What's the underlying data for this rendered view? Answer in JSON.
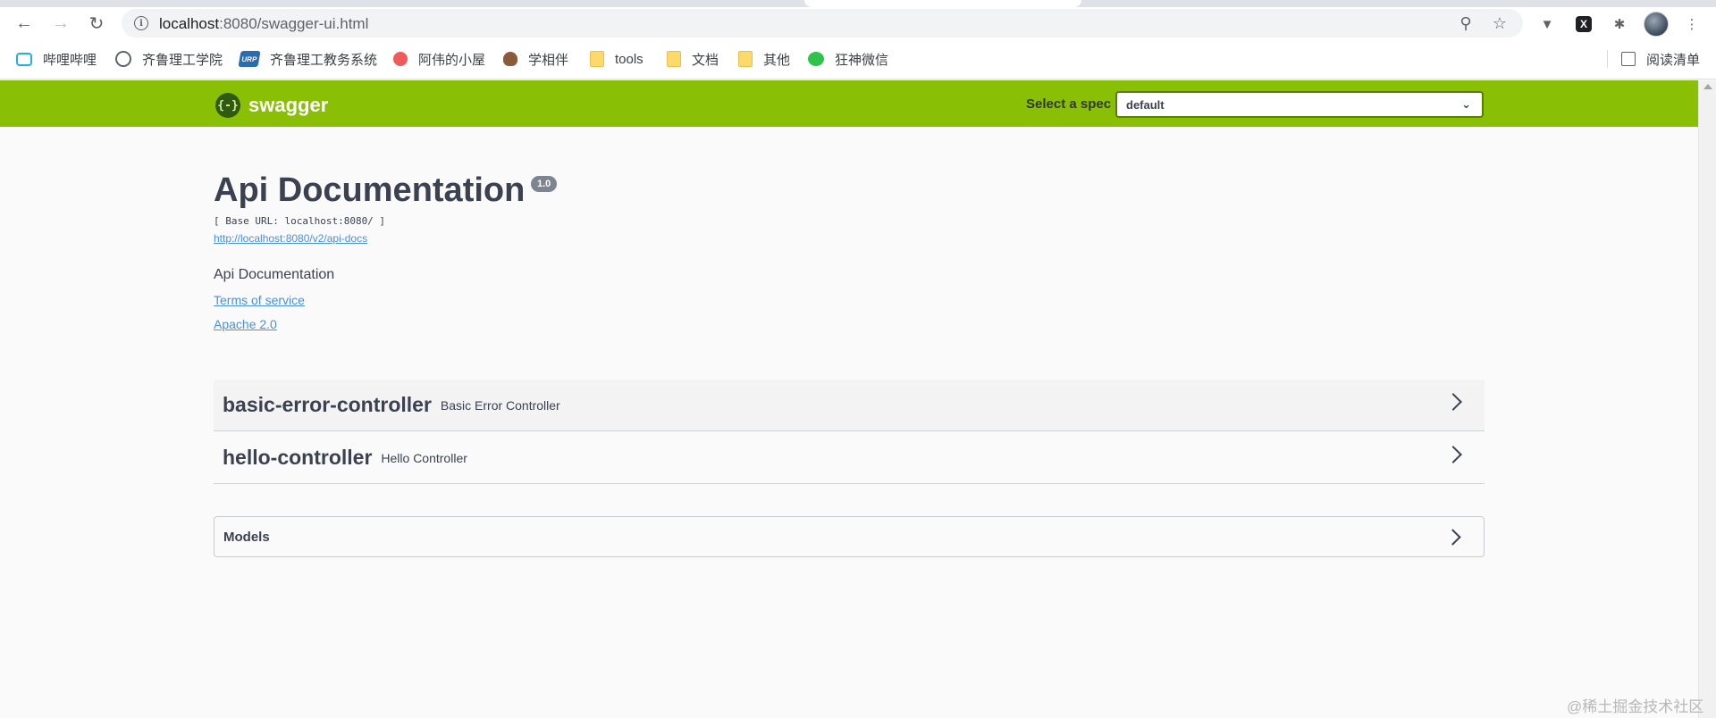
{
  "browser": {
    "url_host": "localhost",
    "url_rest": ":8080/swagger-ui.html",
    "bookmarks": [
      {
        "label": "哔哩哔哩",
        "icon": "bilibili-icon"
      },
      {
        "label": "齐鲁理工学院",
        "icon": "globe-icon"
      },
      {
        "label": "齐鲁理工教务系统",
        "icon": "urp-icon"
      },
      {
        "label": "阿伟的小屋",
        "icon": "peach-icon"
      },
      {
        "label": "学相伴",
        "icon": "avatar-icon"
      },
      {
        "label": "tools",
        "icon": "folder-icon"
      },
      {
        "label": "文档",
        "icon": "folder-icon"
      },
      {
        "label": "其他",
        "icon": "folder-icon"
      },
      {
        "label": "狂神微信",
        "icon": "wechat-icon"
      }
    ],
    "reading_list": "阅读清单",
    "urp_badge": "URP"
  },
  "swagger": {
    "logo_text": "swagger",
    "logo_glyph": "{-}",
    "select_label": "Select a spec",
    "selected_spec": "default"
  },
  "info": {
    "title": "Api Documentation",
    "version": "1.0",
    "base_url": "[ Base URL: localhost:8080/ ]",
    "docs_link": "http://localhost:8080/v2/api-docs",
    "description": "Api Documentation",
    "terms": "Terms of service",
    "license": "Apache 2.0"
  },
  "controllers": [
    {
      "name": "basic-error-controller",
      "description": "Basic Error Controller"
    },
    {
      "name": "hello-controller",
      "description": "Hello Controller"
    }
  ],
  "models_label": "Models",
  "watermark": "@稀土掘金技术社区",
  "colors": {
    "topbar": "#89bf04",
    "link": "#4990e2",
    "text": "#3b4151"
  }
}
